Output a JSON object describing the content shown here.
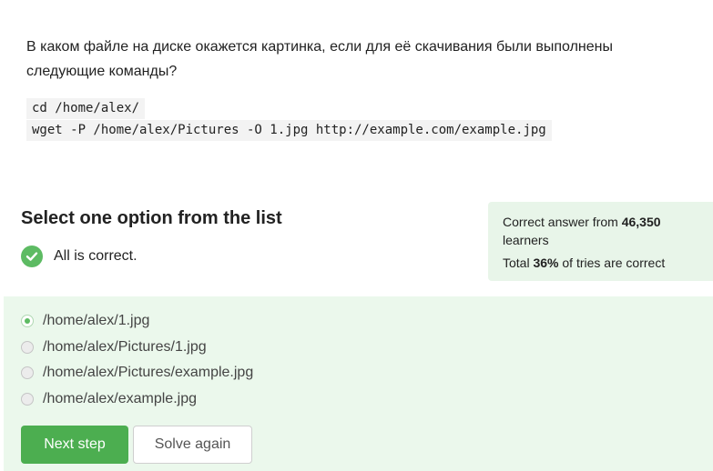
{
  "question": {
    "text": "В каком файле на диске окажется картинка, если для её скачивания были выполнены следующие команды?",
    "code_lines": [
      "cd /home/alex/",
      "wget -P /home/alex/Pictures -O 1.jpg http://example.com/example.jpg"
    ]
  },
  "quiz": {
    "title": "Select one option from the list",
    "status_text": "All is correct."
  },
  "stats": {
    "correct_prefix": "Correct answer from",
    "learners_count": "46,350",
    "learners_suffix": "learners",
    "total_prefix": "Total",
    "percent": "36%",
    "total_suffix": "of tries are correct"
  },
  "options": [
    {
      "label": "/home/alex/1.jpg",
      "selected": true
    },
    {
      "label": "/home/alex/Pictures/1.jpg",
      "selected": false
    },
    {
      "label": "/home/alex/Pictures/example.jpg",
      "selected": false
    },
    {
      "label": "/home/alex/example.jpg",
      "selected": false
    }
  ],
  "buttons": {
    "next_label": "Next step",
    "again_label": "Solve again"
  },
  "colors": {
    "accent": "#4cae50",
    "panel_bg": "#ebf8ec",
    "stats_bg": "#e8f5e9"
  },
  "icons": {
    "status": "check-circle-icon"
  }
}
